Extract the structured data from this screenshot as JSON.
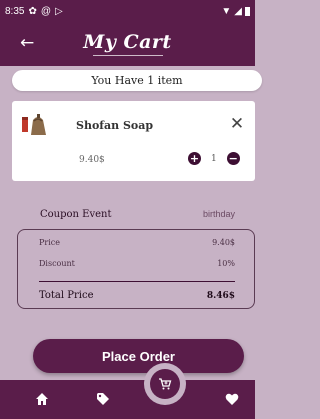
{
  "status_bar": {
    "time": "8:35"
  },
  "header": {
    "title": "My Cart"
  },
  "cart": {
    "count_text": "You Have 1 item",
    "items": [
      {
        "name": "Shofan Soap",
        "price": "9.40$",
        "quantity": "1"
      }
    ]
  },
  "coupon": {
    "label": "Coupon Event",
    "value": "birthday"
  },
  "summary": {
    "price_label": "Price",
    "price_value": "9.40$",
    "discount_label": "Discount",
    "discount_value": "10%",
    "total_label": "Total Price",
    "total_value": "8.46$"
  },
  "actions": {
    "place_order_label": "Place Order"
  },
  "nav": {
    "items": [
      "home-icon",
      "tag-icon",
      "cart-icon",
      "heart-icon"
    ]
  },
  "colors": {
    "primary": "#5a1d4a",
    "background": "#c7b2c5",
    "card": "#ffffff"
  }
}
